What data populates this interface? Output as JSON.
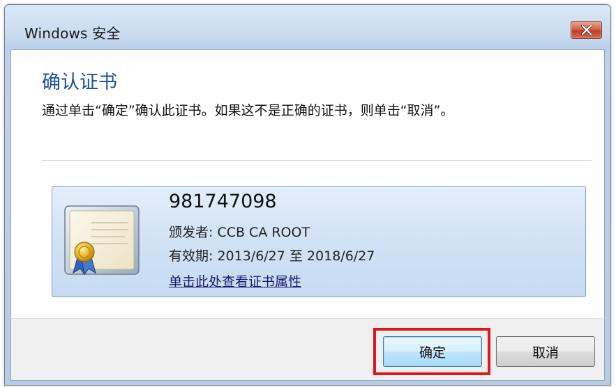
{
  "window": {
    "title": "Windows 安全"
  },
  "header": {
    "heading": "确认证书",
    "description": "通过单击“确定”确认此证书。如果这不是正确的证书，则单击“取消”。"
  },
  "certificate": {
    "name": "981747098",
    "issuer": "颁发者: CCB CA ROOT",
    "validity": "有效期: 2013/6/27 至 2018/6/27",
    "details_link": "单击此处查看证书属性",
    "icon": "certificate-icon"
  },
  "buttons": {
    "ok_label": "确定",
    "cancel_label": "取消"
  },
  "annotation": {
    "highlight_color": "#e0161b",
    "highlight_target": "ok-button"
  },
  "colors": {
    "heading": "#1b4f9c",
    "close_button": "#c0401f",
    "cert_box": "#d1e2f5"
  }
}
